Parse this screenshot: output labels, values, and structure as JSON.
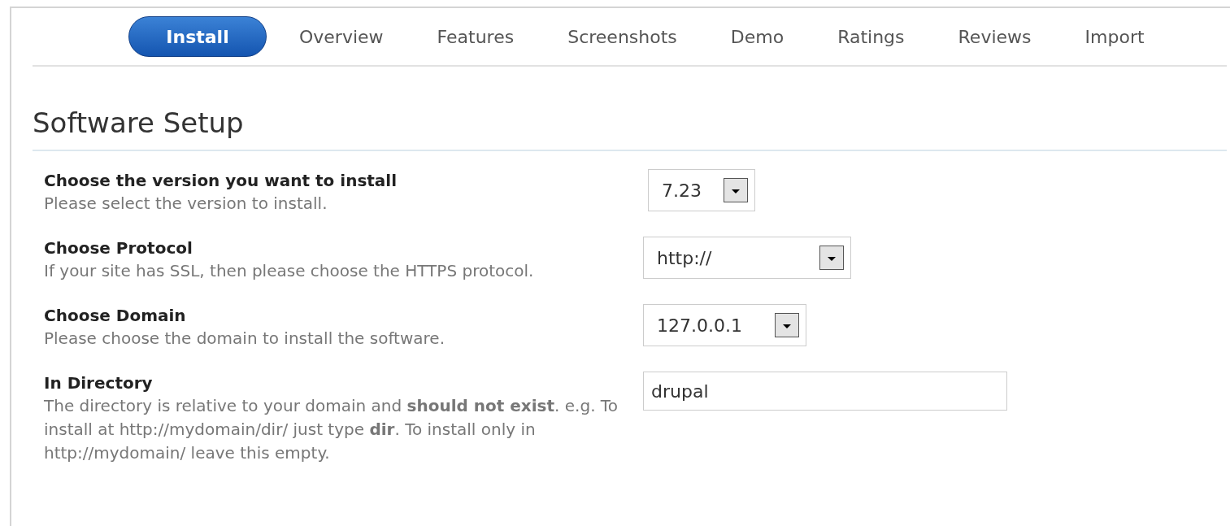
{
  "tabs": [
    {
      "label": "Install",
      "selected": true
    },
    {
      "label": "Overview",
      "selected": false
    },
    {
      "label": "Features",
      "selected": false
    },
    {
      "label": "Screenshots",
      "selected": false
    },
    {
      "label": "Demo",
      "selected": false
    },
    {
      "label": "Ratings",
      "selected": false
    },
    {
      "label": "Reviews",
      "selected": false
    },
    {
      "label": "Import",
      "selected": false
    }
  ],
  "heading": "Software Setup",
  "fields": [
    {
      "label": "Choose the version you want to install",
      "description": "Please select the version to install.",
      "kind": "select",
      "value": "7.23"
    },
    {
      "label": "Choose Protocol",
      "description": "If your site has SSL, then please choose the HTTPS protocol.",
      "kind": "select",
      "value": "http://"
    },
    {
      "label": "Choose Domain",
      "description": "Please choose the domain to install the software.",
      "kind": "select",
      "value": "127.0.0.1"
    },
    {
      "label": "In Directory",
      "description": "The directory is relative to your domain and **should not exist**. e.g. To install at http://mydomain/dir/ just type **dir**. To install only in http://mydomain/ leave this empty.",
      "kind": "text",
      "value": "drupal"
    }
  ]
}
